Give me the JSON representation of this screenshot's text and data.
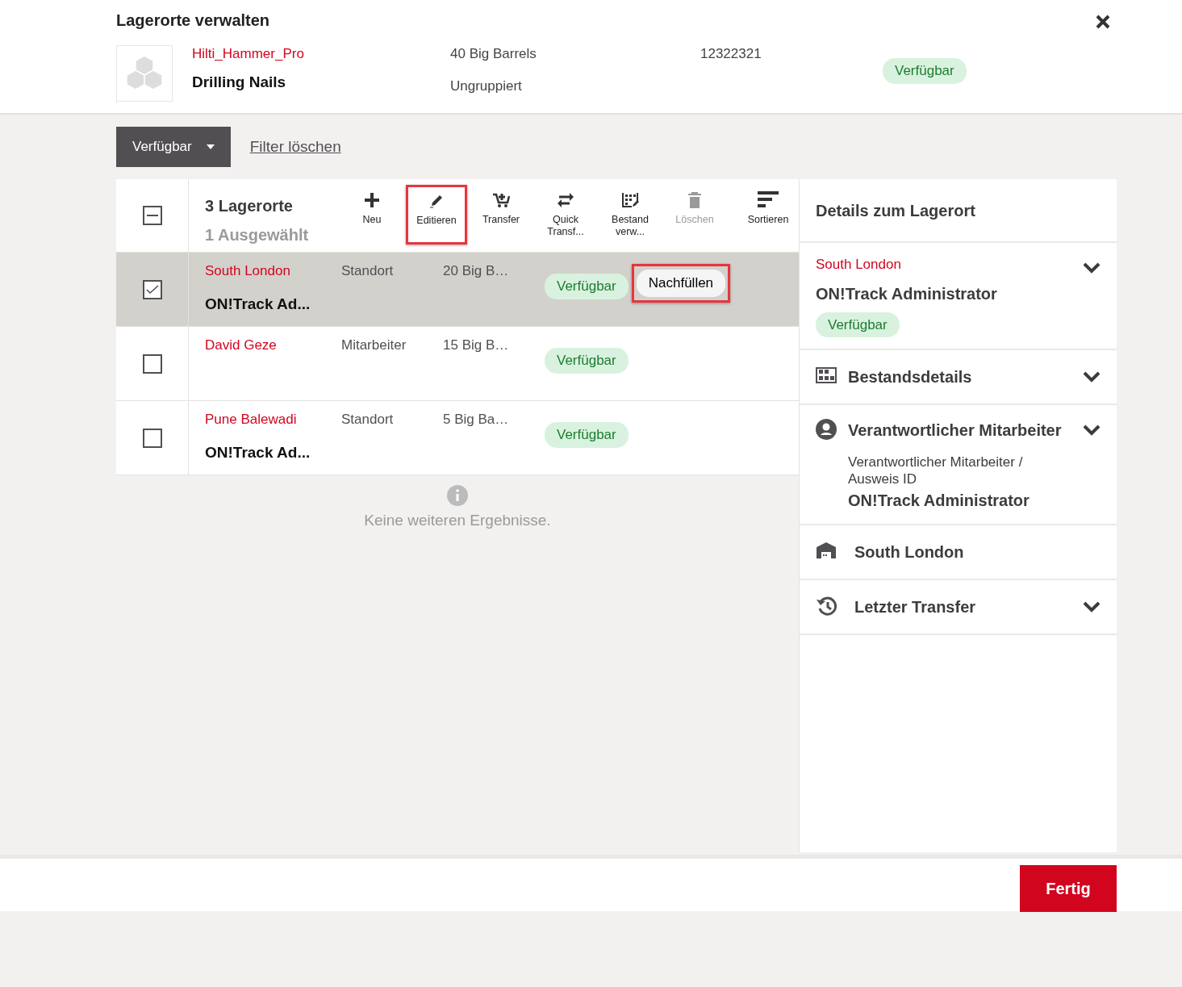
{
  "dialog": {
    "title": "Lagerorte verwalten"
  },
  "item": {
    "owner": "Hilti_Hammer_Pro",
    "name": "Drilling Nails",
    "quantity": "40 Big Barrels",
    "group": "Ungruppiert",
    "number": "12322321",
    "status": "Verfügbar"
  },
  "filter": {
    "dropdown": "Verfügbar",
    "clear_link": "Filter löschen"
  },
  "toolbar": {
    "select_all": {
      "partial": true
    },
    "count": "3 Lagerorte",
    "selected_count": "1 Ausgewählt",
    "tools": [
      {
        "kind": "plus",
        "label": "Neu",
        "disabled": false,
        "highlighted": false
      },
      {
        "kind": "pencil",
        "label": "Editieren",
        "disabled": false,
        "highlighted": true
      },
      {
        "kind": "cart",
        "label": "Transfer",
        "disabled": false,
        "highlighted": false
      },
      {
        "kind": "swap",
        "label": "Quick Transf...",
        "disabled": false,
        "highlighted": false
      },
      {
        "kind": "grid",
        "label": "Bestand verw...",
        "disabled": false,
        "highlighted": false
      },
      {
        "kind": "trash",
        "label": "Löschen",
        "disabled": true,
        "highlighted": false
      }
    ],
    "sort": {
      "label": "Sortieren"
    }
  },
  "rows": [
    {
      "selected": true,
      "name": "South London",
      "subtitle": "ON!Track Ad...",
      "type": "Standort",
      "quantity": "20 Big B…",
      "status": "Verfügbar",
      "action": {
        "label": "Nachfüllen",
        "highlighted": true
      }
    },
    {
      "selected": false,
      "name": "David Geze",
      "type": "Mitarbeiter",
      "quantity": "15 Big B…",
      "status": "Verfügbar"
    },
    {
      "selected": false,
      "name": "Pune Balewadi",
      "subtitle": "ON!Track Ad...",
      "type": "Standort",
      "quantity": "5 Big Ba…",
      "status": "Verfügbar"
    }
  ],
  "end_message": "Keine weiteren Ergebnisse.",
  "details": {
    "title": "Details zum Lagerort",
    "summary": {
      "name": "South London",
      "owner": "ON!Track Administrator",
      "status": "Verfügbar",
      "expanded": false
    },
    "sections": [
      {
        "kind": "stock",
        "title": "Bestandsdetails",
        "expandable": true
      },
      {
        "kind": "person",
        "title": "Verantwortlicher Mitarbeiter",
        "expandable": true,
        "field_label": "Verantwortlicher Mitarbeiter / Ausweis ID",
        "field_value": "ON!Track Administrator"
      },
      {
        "kind": "location",
        "title": "South London",
        "expandable": false
      },
      {
        "kind": "history",
        "title": "Letzter Transfer",
        "expandable": true
      }
    ]
  },
  "footer": {
    "done_button": "Fertig"
  }
}
